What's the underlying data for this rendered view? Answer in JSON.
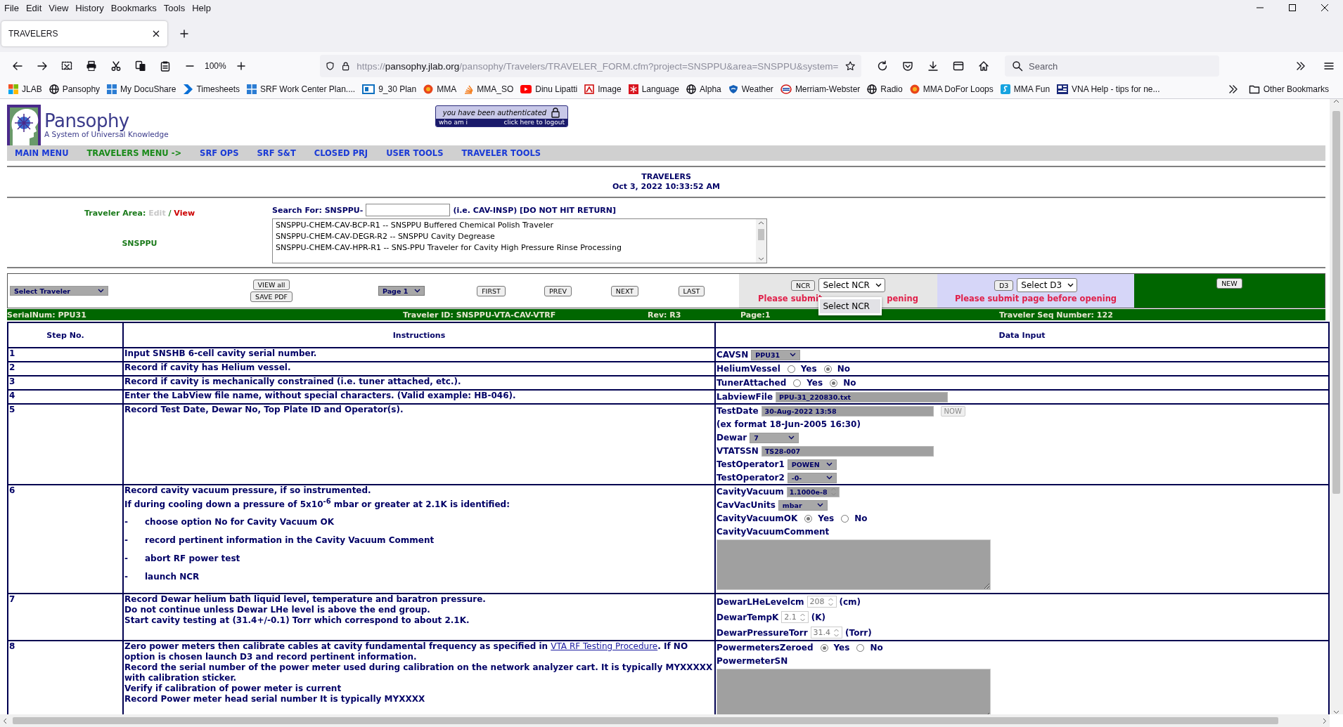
{
  "browser": {
    "menu": [
      "File",
      "Edit",
      "View",
      "History",
      "Bookmarks",
      "Tools",
      "Help"
    ],
    "tabs": [
      {
        "title": "TRAVELERS",
        "selected": true
      }
    ],
    "zoom": "100%",
    "url": {
      "scheme": "https://",
      "host": "pansophy.jlab.org",
      "path": "/pansophy/Travelers/TRAVELER_FORM.cfm?project=SNSPPU&area=SNSPPU&system="
    },
    "search": {
      "placeholder": "Search"
    },
    "bookmarks": [
      {
        "label": "JLAB",
        "kind": "tiles"
      },
      {
        "label": "Pansophy",
        "kind": "globe"
      },
      {
        "label": "My DocuShare",
        "kind": "panes"
      },
      {
        "label": "Timesheets",
        "kind": "chevron"
      },
      {
        "label": "SRF Work Center Plan....",
        "kind": "panes"
      },
      {
        "label": "9_30 Plan",
        "kind": "box"
      },
      {
        "label": "MMA",
        "kind": "sun"
      },
      {
        "label": "MMA_SO",
        "kind": "stack"
      },
      {
        "label": "Dinu Lipatti",
        "kind": "play"
      },
      {
        "label": "Image",
        "kind": "document"
      },
      {
        "label": "Language",
        "kind": "snowflake"
      },
      {
        "label": "Alpha",
        "kind": "globe"
      },
      {
        "label": "Weather",
        "kind": "shield"
      },
      {
        "label": "Merriam-Webster",
        "kind": "ring"
      },
      {
        "label": "Radio",
        "kind": "globe"
      },
      {
        "label": "MMA DoFor Loops",
        "kind": "sun"
      },
      {
        "label": "MMA Fun",
        "kind": "square"
      },
      {
        "label": "VNA Help - tips for ne...",
        "kind": "screen"
      }
    ],
    "other_bookmarks": "Other Bookmarks"
  },
  "site": {
    "logo_title": "Pansophy",
    "logo_subtitle": "A System of Universal Knowledge",
    "auth": {
      "message": "you have been authenticated",
      "who": "who am i",
      "logout": "click here to logout"
    },
    "nav": [
      {
        "label": "MAIN MENU",
        "selected": false
      },
      {
        "label": "TRAVELERS MENU ->",
        "selected": true
      },
      {
        "label": "SRF OPS",
        "selected": false
      },
      {
        "label": "SRF S&T",
        "selected": false
      },
      {
        "label": "CLOSED PRJ",
        "selected": false
      },
      {
        "label": "USER TOOLS",
        "selected": false
      },
      {
        "label": "TRAVELER TOOLS",
        "selected": false
      }
    ]
  },
  "heading": {
    "title": "TRAVELERS",
    "datetime": "Oct 3, 2022 10:33:52 AM"
  },
  "area": {
    "label": "Traveler Area:",
    "modes": [
      {
        "label": "Edit",
        "disabled": true
      },
      {
        "label": "View",
        "disabled": false
      }
    ],
    "separator": "/",
    "name": "SNSPPU"
  },
  "search": {
    "label": "Search For: SNSPPU-",
    "hint": "(i.e. CAV-INSP) [DO NOT HIT RETURN]",
    "results": [
      "SNSPPU-CHEM-CAV-BCP-R1 -- SNSPPU Buffered Chemical Polish Traveler",
      "SNSPPU-CHEM-CAV-DEGR-R2 -- SNSPPU Cavity Degrease",
      "SNSPPU-CHEM-CAV-HPR-R1 -- SNS-PPU Traveler for Cavity High Pressure Rinse Processing"
    ]
  },
  "toolbar": {
    "traveler_select": "Select Traveler",
    "view_all": "VIEW all",
    "save_pdf": "SAVE PDF",
    "page_select": "Page 1",
    "pager": [
      "FIRST",
      "PREV",
      "NEXT",
      "LAST"
    ],
    "ncr": {
      "button": "NCR",
      "select": "Select NCR",
      "expanded": true,
      "option": "Select NCR",
      "notice_parts": [
        "Please submit",
        "pening"
      ]
    },
    "d3": {
      "button": "D3",
      "select": "Select D3",
      "notice": "Please submit page before opening"
    },
    "new": "NEW"
  },
  "info_bar": {
    "serial": "SerialNum: PPU31",
    "traveler_id": "Traveler ID: SNSPPU-VTA-CAV-VTRF",
    "rev": "Rev: R3",
    "page": "Page:1",
    "seq": "Traveler Seq Number: 122"
  },
  "table": {
    "columns": [
      "Step No.",
      "Instructions",
      "Data Input"
    ],
    "rows": [
      {
        "step": "1",
        "instructions": [
          {
            "kind": "text",
            "text": "Input SNSHB 6-cell cavity serial number."
          }
        ],
        "inputs": [
          {
            "kind": "select",
            "label": "CAVSN",
            "value": "PPU31"
          }
        ]
      },
      {
        "step": "2",
        "instructions": [
          {
            "kind": "text",
            "text": "Record if cavity has Helium vessel."
          }
        ],
        "inputs": [
          {
            "kind": "radio",
            "label": "HeliumVessel",
            "options": [
              {
                "label": "Yes",
                "selected": false
              },
              {
                "label": "No",
                "selected": true
              }
            ]
          }
        ]
      },
      {
        "step": "3",
        "instructions": [
          {
            "kind": "text",
            "text": "Record if cavity is mechanically constrained (i.e. tuner attached, etc.)."
          }
        ],
        "inputs": [
          {
            "kind": "radio",
            "label": "TunerAttached",
            "options": [
              {
                "label": "Yes",
                "selected": false
              },
              {
                "label": "No",
                "selected": true
              }
            ]
          }
        ]
      },
      {
        "step": "4",
        "instructions": [
          {
            "kind": "text",
            "text": "Enter the LabView file name, without special characters. (Valid example: HB-046)."
          }
        ],
        "inputs": [
          {
            "kind": "text",
            "label": "LabviewFile",
            "value": "PPU-31_220830.txt"
          }
        ]
      },
      {
        "step": "5",
        "instructions": [
          {
            "kind": "text",
            "text": "Record Test Date, Dewar No, Top Plate ID and Operator(s)."
          }
        ],
        "inputs": [
          {
            "kind": "text",
            "label": "TestDate",
            "value": "30-Aug-2022 13:58",
            "button": "NOW"
          },
          {
            "kind": "note",
            "text": "(ex format 18-Jun-2005 16:30)"
          },
          {
            "kind": "select",
            "label": "Dewar",
            "value": "7"
          },
          {
            "kind": "text",
            "label": "VTATSSN",
            "value": "TS28-007"
          },
          {
            "kind": "select",
            "label": "TestOperator1",
            "value": "POWEN"
          },
          {
            "kind": "select",
            "label": "TestOperator2",
            "value": "-0-"
          }
        ]
      },
      {
        "step": "6",
        "instructions": [
          {
            "kind": "text",
            "text": "Record cavity vacuum pressure, if so instrumented."
          },
          {
            "kind": "text",
            "text": "If during cooling down a pressure of 5x10$^{-6}$ mbar or greater at 2.1K is identified:"
          },
          {
            "kind": "bullet",
            "marker": "-",
            "text": "choose option No for Cavity Vacuum OK"
          },
          {
            "kind": "bullet",
            "marker": "-",
            "text": "record pertinent information in the Cavity Vacuum Comment"
          },
          {
            "kind": "bullet",
            "marker": "-",
            "text": "abort RF power test"
          },
          {
            "kind": "bullet",
            "marker": "-",
            "text": "launch NCR"
          }
        ],
        "inputs": [
          {
            "kind": "spin",
            "label": "CavityVacuum",
            "value": "1.1000e-8"
          },
          {
            "kind": "select",
            "label": "CavVacUnits",
            "value": "mbar"
          },
          {
            "kind": "radio",
            "label": "CavityVacuumOK",
            "options": [
              {
                "label": "Yes",
                "selected": true
              },
              {
                "label": "No",
                "selected": false
              }
            ]
          },
          {
            "kind": "textarea",
            "label": "CavityVacuumComment"
          }
        ]
      },
      {
        "step": "7",
        "instructions": [
          {
            "kind": "text",
            "text": "Record Dewar helium bath liquid level, temperature and baratron pressure."
          },
          {
            "kind": "text",
            "text": "Do not continue unless Dewar LHe level is above the end group."
          },
          {
            "kind": "text",
            "text": "Start cavity testing at (31.4+/-0.1) Torr which correspond to about 2.1K."
          }
        ],
        "inputs": [
          {
            "kind": "number",
            "label": "DewarLHeLevelcm",
            "value": "208",
            "unit": "(cm)"
          },
          {
            "kind": "number",
            "label": "DewarTempK",
            "value": "2.1",
            "unit": "(K)"
          },
          {
            "kind": "number",
            "label": "DewarPressureTorr",
            "value": "31.4",
            "unit": "(Torr)"
          }
        ]
      },
      {
        "step": "8",
        "instructions": [
          {
            "kind": "link-text",
            "before": "Zero power meters then calibrate cables at cavity fundamental frequency as specified in ",
            "link": "VTA RF Testing Procedure",
            "after": ". If NO option is chosen launch D3 and record pertinent information."
          },
          {
            "kind": "text",
            "text": "Record the serial number of the power meter used during calibration on the network analyzer cart. It is typically MYXXXXX with calibration sticker."
          },
          {
            "kind": "text",
            "text": "Verify if calibration of power meter is current"
          },
          {
            "kind": "text",
            "text": "Record Power meter head serial number It is typically MYXXXX"
          }
        ],
        "inputs": [
          {
            "kind": "radio",
            "label": "PowermetersZeroed",
            "options": [
              {
                "label": "Yes",
                "selected": true
              },
              {
                "label": "No",
                "selected": false
              }
            ]
          },
          {
            "kind": "textarea",
            "label": "PowermeterSN"
          }
        ]
      }
    ]
  }
}
